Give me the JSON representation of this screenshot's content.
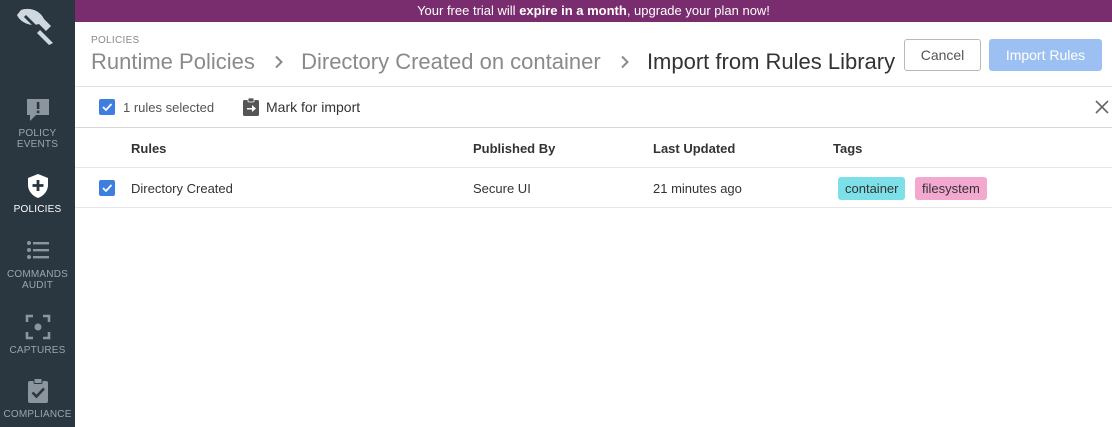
{
  "banner": {
    "text_before": "Your free trial will ",
    "text_bold": "expire in a month",
    "text_after": ", upgrade your plan now!"
  },
  "sidebar": {
    "items": [
      {
        "label_line1": "Policy",
        "label_line2": "Events",
        "icon": "alert-message-icon",
        "active": false
      },
      {
        "label_line1": "Policies",
        "label_line2": "",
        "icon": "shield-plus-icon",
        "active": true
      },
      {
        "label_line1": "Commands",
        "label_line2": "Audit",
        "icon": "list-icon",
        "active": false
      },
      {
        "label_line1": "Captures",
        "label_line2": "",
        "icon": "capture-focus-icon",
        "active": false
      },
      {
        "label_line1": "Compliance",
        "label_line2": "",
        "icon": "clipboard-check-icon",
        "active": false
      }
    ]
  },
  "header": {
    "section_label": "POLICIES",
    "breadcrumb": [
      "Runtime Policies",
      "Directory Created on container"
    ],
    "current": "Import from Rules Library",
    "cancel_label": "Cancel",
    "import_label": "Import Rules"
  },
  "toolbar": {
    "selected_text": "1 rules selected",
    "mark_label": "Mark for import"
  },
  "table": {
    "columns": [
      "Rules",
      "Published By",
      "Last Updated",
      "Tags"
    ],
    "rows": [
      {
        "checked": true,
        "rule": "Directory Created",
        "published_by": "Secure UI",
        "last_updated": "21 minutes ago",
        "tags": [
          "container",
          "filesystem"
        ]
      }
    ]
  },
  "colors": {
    "sidebar_bg": "#2a3741",
    "banner_bg": "#7a2d6e",
    "accent_blue": "#3d7fe0",
    "import_button_bg": "#9dc0f2",
    "tag_container": "#7de0e8",
    "tag_filesystem": "#f3a8cf"
  }
}
